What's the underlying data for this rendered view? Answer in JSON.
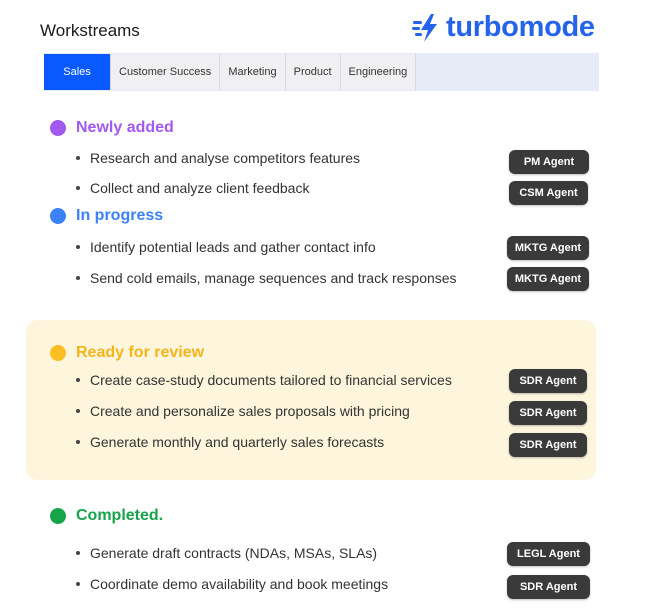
{
  "header": {
    "title": "Workstreams",
    "brand": "turbomode"
  },
  "tabs": [
    {
      "label": "Sales",
      "active": true
    },
    {
      "label": "Customer Success",
      "active": false
    },
    {
      "label": "Marketing",
      "active": false
    },
    {
      "label": "Product",
      "active": false
    },
    {
      "label": "Engineering",
      "active": false
    }
  ],
  "colors": {
    "accent": "#0a58ff",
    "brand": "#2563eb",
    "newly": "#a259f0",
    "progress": "#3b82f6",
    "review": "#fbbf24",
    "completed": "#16a34a"
  },
  "sections": {
    "newly": {
      "label": "Newly added",
      "tasks": [
        {
          "text": "Research and analyse competitors features",
          "agent": "PM Agent"
        },
        {
          "text": "Collect and analyze client feedback",
          "agent": "CSM Agent"
        }
      ]
    },
    "progress": {
      "label": "In progress",
      "tasks": [
        {
          "text": "Identify potential leads and gather contact info",
          "agent": "MKTG Agent"
        },
        {
          "text": "Send cold emails, manage sequences and track responses",
          "agent": "MKTG Agent"
        }
      ]
    },
    "review": {
      "label": "Ready for review",
      "tasks": [
        {
          "text": "Create case-study documents tailored to financial services",
          "agent": "SDR Agent"
        },
        {
          "text": "Create and personalize sales proposals with pricing",
          "agent": "SDR Agent"
        },
        {
          "text": "Generate monthly and quarterly sales forecasts",
          "agent": "SDR Agent"
        }
      ]
    },
    "completed": {
      "label": "Completed.",
      "tasks": [
        {
          "text": "Generate draft contracts (NDAs, MSAs, SLAs)",
          "agent": "LEGL Agent"
        },
        {
          "text": "Coordinate demo availability and book meetings",
          "agent": "SDR Agent"
        }
      ]
    }
  }
}
